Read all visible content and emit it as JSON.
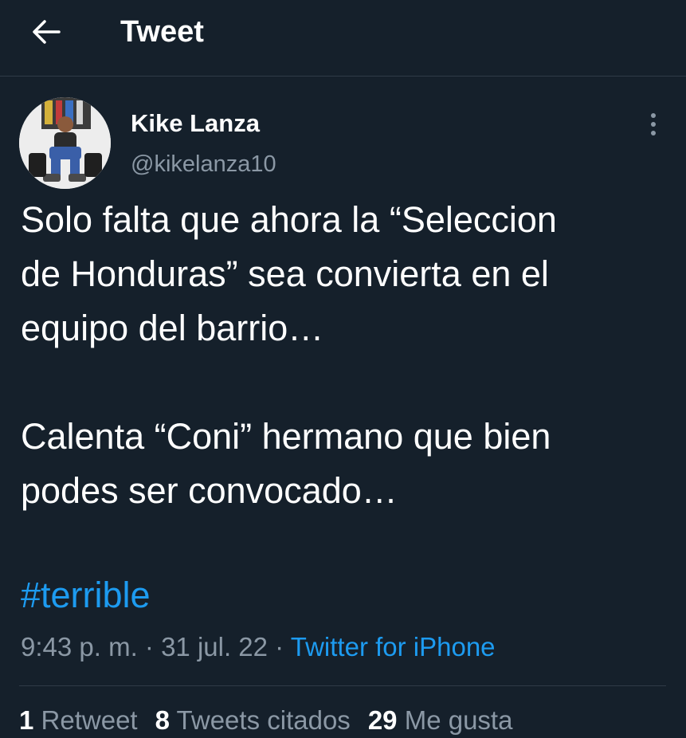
{
  "header": {
    "title": "Tweet",
    "back_icon": "arrow-left-icon"
  },
  "author": {
    "display_name": "Kike Lanza",
    "handle": "@kikelanza10",
    "more_icon": "more-vertical-icon"
  },
  "tweet": {
    "paragraph_1_line_1": "Solo falta que ahora la “Seleccion",
    "paragraph_1_line_2": "de Honduras” sea convierta en el",
    "paragraph_1_line_3": "equipo del barrio…",
    "paragraph_2_line_1": "Calenta “Coni” hermano que bien",
    "paragraph_2_line_2": "podes ser convocado…",
    "hashtag": "#terrible"
  },
  "meta": {
    "time": "9:43 p. m.",
    "separator_1": " · ",
    "date": "31 jul. 22",
    "separator_2": " · ",
    "source": "Twitter for iPhone"
  },
  "stats": {
    "retweets_count": "1",
    "retweets_label": "Retweet",
    "quotes_count": "8",
    "quotes_label": "Tweets citados",
    "likes_count": "29",
    "likes_label": "Me gusta"
  },
  "colors": {
    "background": "#15202b",
    "accent": "#1d9bf0",
    "secondary_text": "#8b98a5"
  }
}
